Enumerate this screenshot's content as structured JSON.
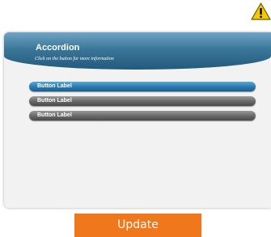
{
  "panel": {
    "title": "Accordion",
    "subtitle": "Click on the button for more information",
    "buttons": [
      {
        "label": "Button Label",
        "state": "active"
      },
      {
        "label": "Button Label",
        "state": "inactive"
      },
      {
        "label": "Button Label",
        "state": "inactive"
      }
    ]
  },
  "footer": {
    "update_label": "Update"
  },
  "icons": {
    "warning": "warning-triangle-icon"
  },
  "colors": {
    "header_blue": "#3b7699",
    "active_button": "#2a7db3",
    "inactive_button": "#6b6b6b",
    "update_button": "#f0771b",
    "warning_yellow": "#f5c800"
  }
}
